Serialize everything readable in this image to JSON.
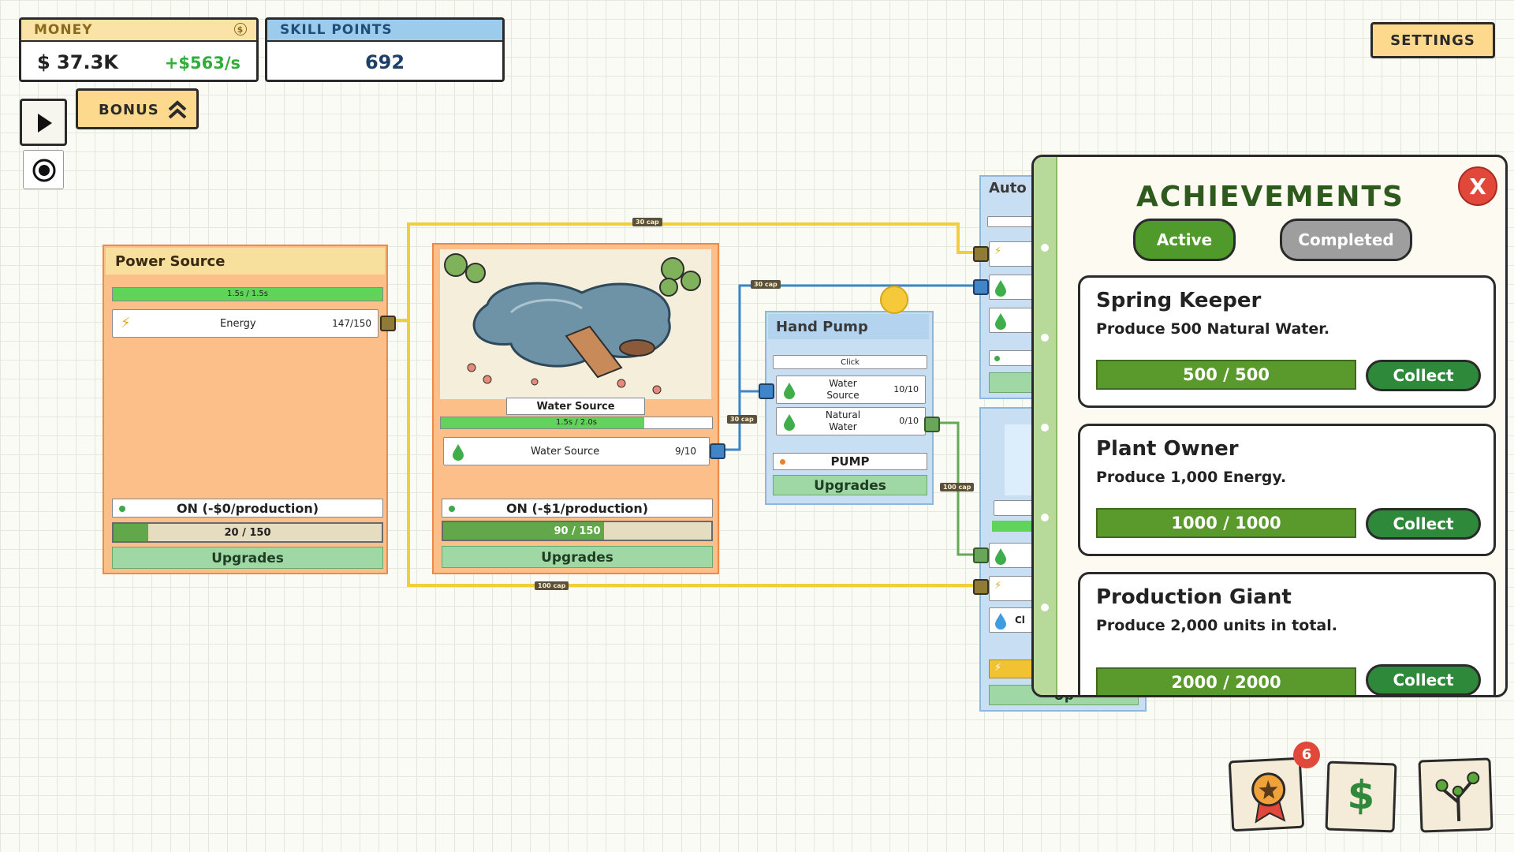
{
  "hud": {
    "money_label": "MONEY",
    "money_value": "$ 37.3K",
    "money_rate": "+$563/s",
    "skill_label": "SKILL POINTS",
    "skill_value": "692",
    "bonus_label": "BONUS",
    "settings_label": "SETTINGS"
  },
  "power_source": {
    "title": "Power Source",
    "timer": "1.5s / 1.5s",
    "timer_progress": 1.0,
    "resource_name": "Energy",
    "resource_count": "147/150",
    "status": "ON  (-$0/production)",
    "storage": "20 / 150",
    "storage_progress": 0.13,
    "upgrades_label": "Upgrades"
  },
  "water_source": {
    "image_label": "Water Source",
    "timer": "1.5s / 2.0s",
    "timer_progress": 0.75,
    "resource_name": "Water Source",
    "resource_count": "9/10",
    "status": "ON  (-$1/production)",
    "storage": "90 / 150",
    "storage_progress": 0.6,
    "upgrades_label": "Upgrades"
  },
  "hand_pump": {
    "title": "Hand Pump",
    "click_label": "Click",
    "input_name": "Water Source",
    "input_count": "10/10",
    "output_name": "Natural Water",
    "output_count": "0/10",
    "action_label": "PUMP",
    "upgrades_label": "Upgrades"
  },
  "auto_card": {
    "title": "Auto",
    "partial_label": "Up",
    "partial_click": "Cl"
  },
  "connections": {
    "cap_top": "30 cap",
    "cap_mid1": "30 cap",
    "cap_mid2": "30 cap",
    "cap_right": "100 cap",
    "cap_bottom": "100 cap"
  },
  "achievements": {
    "title": "ACHIEVEMENTS",
    "tab_active": "Active",
    "tab_completed": "Completed",
    "close_label": "X",
    "items": [
      {
        "name": "Spring Keeper",
        "desc": "Produce 500 Natural Water.",
        "progress": "500 / 500",
        "collect": "Collect"
      },
      {
        "name": "Plant Owner",
        "desc": "Produce 1,000 Energy.",
        "progress": "1000 / 1000",
        "collect": "Collect"
      },
      {
        "name": "Production Giant",
        "desc": "Produce 2,000 units in total.",
        "progress": "2000 / 2000",
        "collect": "Collect"
      }
    ]
  },
  "dock": {
    "achievements_badge": "6",
    "icons": [
      "award-icon",
      "dollar-icon",
      "skill-tree-icon"
    ]
  },
  "colors": {
    "accent_green": "#2e8a3a",
    "orange_card": "#fcbf8a",
    "blue_card": "#c8dff3",
    "money_rate": "#2fae3a",
    "badge_red": "#e2483a"
  }
}
